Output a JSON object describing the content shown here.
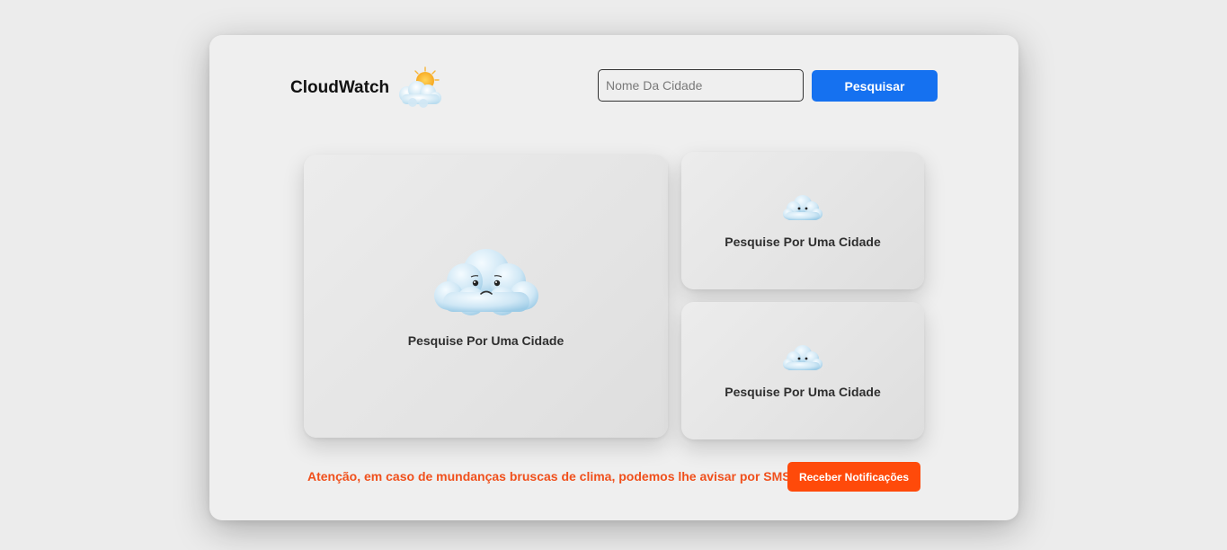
{
  "header": {
    "brand_title": "CloudWatch",
    "brand_icon": "sun-behind-cloud-icon",
    "search_placeholder": "Nome Da Cidade",
    "search_value": "",
    "search_button_label": "Pesquisar"
  },
  "cards": {
    "main": {
      "icon": "sad-cloud-icon",
      "label": "Pesquise Por Uma Cidade"
    },
    "side_1": {
      "icon": "sad-cloud-icon",
      "label": "Pesquise Por Uma Cidade"
    },
    "side_2": {
      "icon": "sad-cloud-icon",
      "label": "Pesquise Por Uma Cidade"
    }
  },
  "footer": {
    "alert_text": "Atenção, em caso de mundanças bruscas de clima, podemos lhe avisar por SMS",
    "notify_button_label": "Receber Notificações"
  },
  "colors": {
    "search_button": "#1571f0",
    "notify_button": "#ff4a0a",
    "alert_text": "#f0501c",
    "background": "#ececec",
    "panel": "#efefef"
  }
}
